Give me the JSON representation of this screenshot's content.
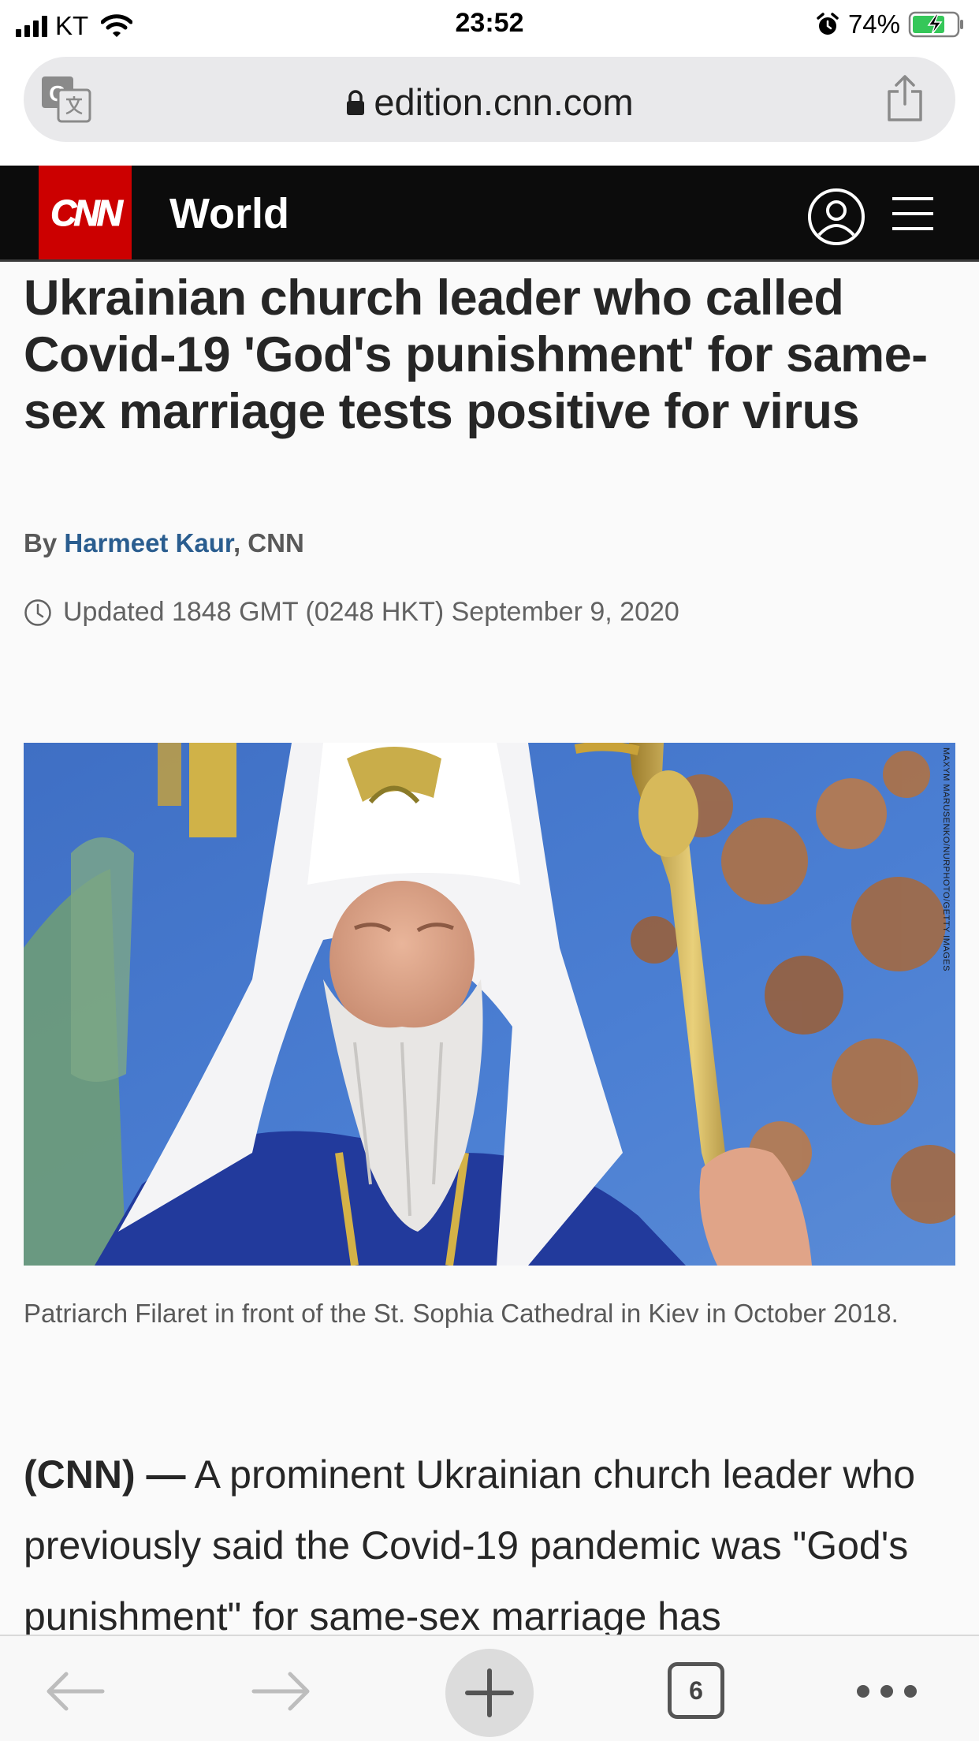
{
  "status_bar": {
    "carrier": "KT",
    "time": "23:52",
    "battery_percent": "74%",
    "battery_level": 0.74,
    "icons": [
      "signal-icon",
      "wifi-icon",
      "alarm-icon",
      "battery-charging-icon"
    ]
  },
  "browser": {
    "url": "edition.cnn.com",
    "icons": [
      "translate-icon",
      "lock-icon",
      "share-icon"
    ]
  },
  "site_header": {
    "logo_text": "CNN",
    "section": "World",
    "icons": [
      "profile-icon",
      "menu-icon"
    ]
  },
  "article": {
    "headline": "Ukrainian church leader who called Covid-19 'God's punishment' for same-sex marriage tests positive for virus",
    "byline_prefix": "By ",
    "author": "Harmeet Kaur",
    "byline_suffix": ", CNN",
    "updated": "Updated 1848 GMT (0248 HKT) September 9, 2020",
    "photo_credit": "MAXYM MARUSENKO/NURPHOTO/GETTY IMAGES",
    "caption": "Patriarch Filaret in front of the St. Sophia Cathedral in Kiev in October 2018.",
    "dateline": "(CNN) —",
    "body": " A prominent Ukrainian church leader who previously said the Covid-19 pandemic was \"God's punishment\" for same-sex marriage has"
  },
  "toolbar": {
    "tab_count": "6",
    "icons": [
      "back-arrow-icon",
      "forward-arrow-icon",
      "new-tab-plus-icon",
      "tabs-icon",
      "more-dots-icon"
    ]
  },
  "colors": {
    "cnn_red": "#cc0000",
    "header_bg": "#0c0c0c",
    "author_link": "#2a5d8f"
  }
}
